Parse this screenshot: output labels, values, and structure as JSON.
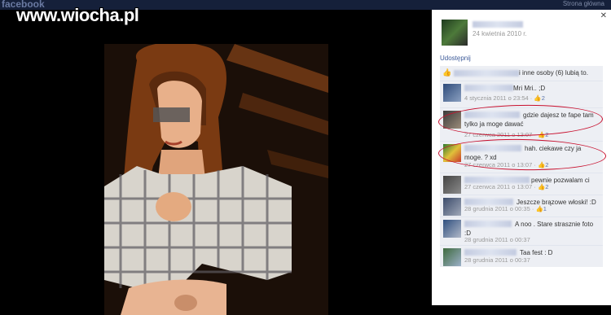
{
  "watermark": "www.wiocha.pl",
  "topbar": {
    "logo": "facebook",
    "link": "Strona główna"
  },
  "owner": {
    "date": "24 kwietnia 2010 r."
  },
  "share_label": "Udostępnij",
  "likes_text": "i inne osoby (6) lubią to.",
  "comments": [
    {
      "text": "Mri Mri.. ;D",
      "meta": "4 stycznia 2011 o 23:54 ·",
      "likes": "2"
    },
    {
      "text": "gdzie dajesz te fape tam tylko ja moge dawać",
      "meta": "27 czerwca 2011 o 13:07 ·",
      "likes": "2"
    },
    {
      "text": "hah. ciekawe czy ja moge. ? xd",
      "meta": "27 czerwca 2011 o 13:07 ·",
      "likes": "2"
    },
    {
      "text": "pewnie pozwalam ci",
      "meta": "27 czerwca 2011 o 13:07 ·",
      "likes": "2"
    },
    {
      "text": "Jeszcze brązowe włoski! :D",
      "meta": "28 grudnia 2011 o 00:35 ·",
      "likes": "1"
    },
    {
      "text": "A noo . Stare strasznie foto :D",
      "meta": "28 grudnia 2011 o 00:37",
      "likes": ""
    },
    {
      "text": "Taa fest : D",
      "meta": "28 grudnia 2011 o 00:37",
      "likes": ""
    }
  ],
  "colors": {
    "link": "#3b5998",
    "highlight_circle": "#c8102e",
    "comment_bg": "#edeff4"
  }
}
